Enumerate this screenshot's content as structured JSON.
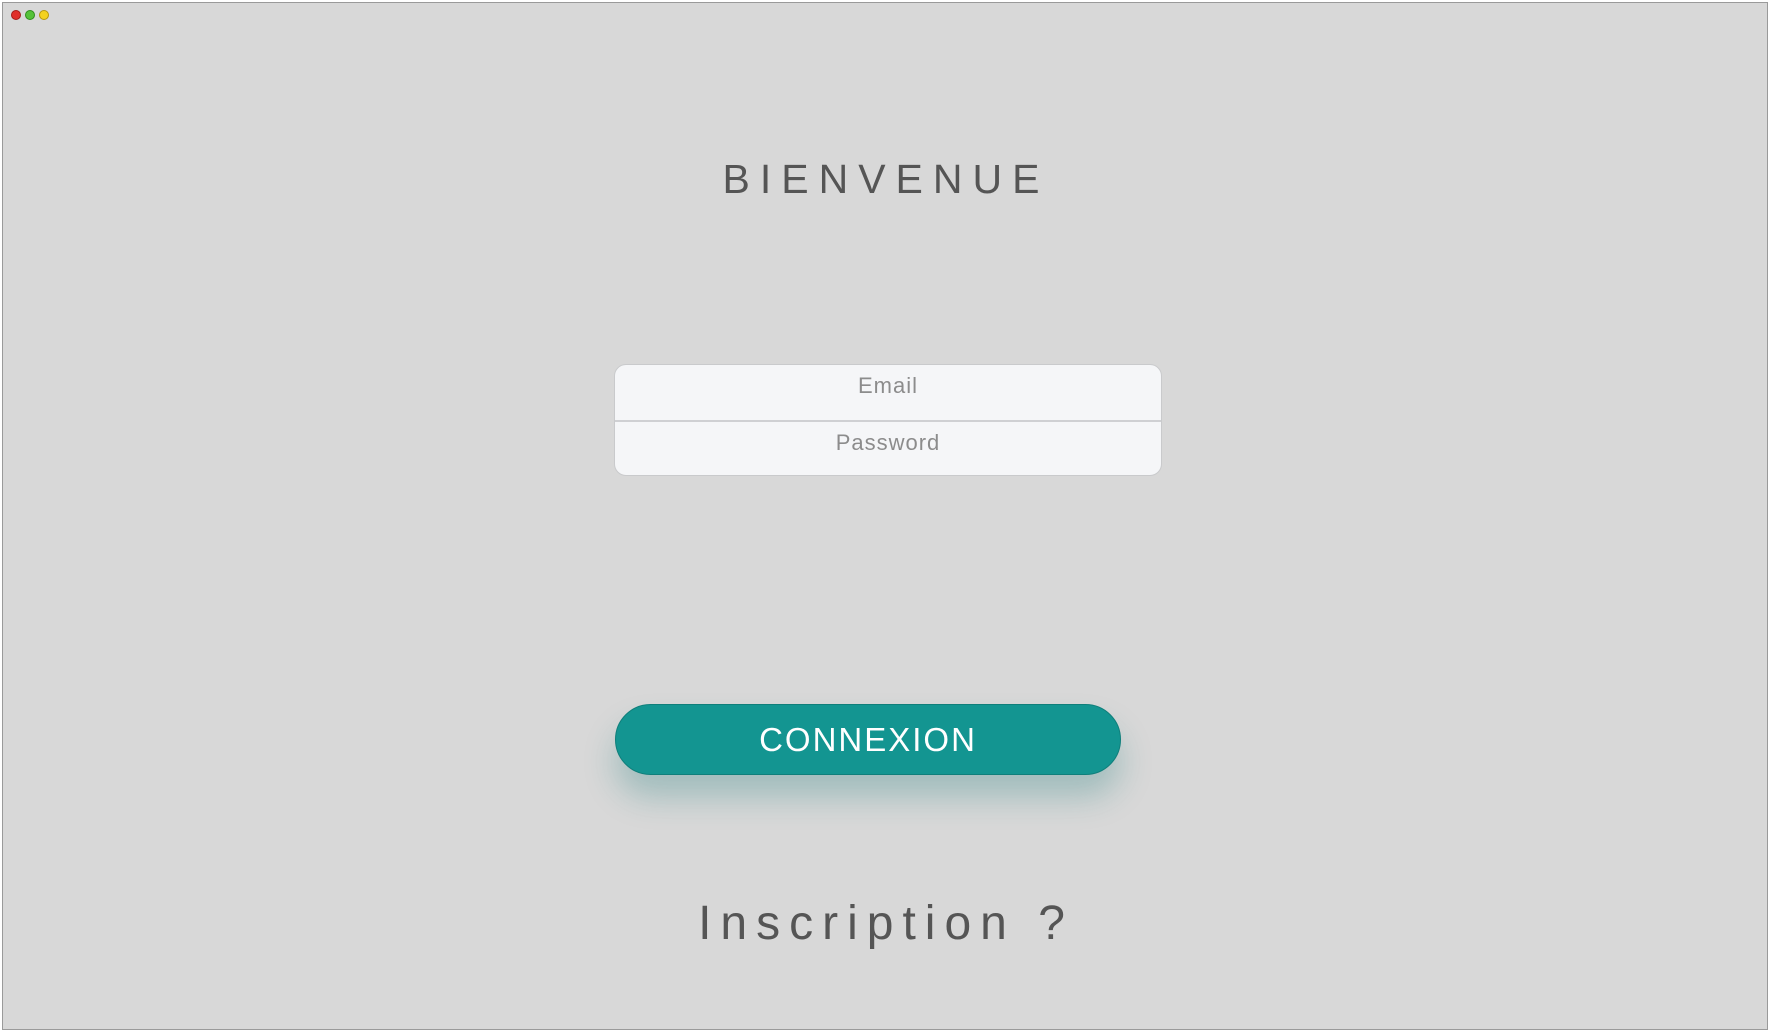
{
  "window": {
    "controls": [
      "close-button",
      "minimize-button",
      "maximize-button"
    ]
  },
  "header": {
    "title": "BIENVENUE"
  },
  "form": {
    "email_placeholder": "Email",
    "email_value": "",
    "password_placeholder": "Password",
    "password_value": ""
  },
  "actions": {
    "connect_label": "CONNEXION",
    "signup_label": "Inscription ?"
  },
  "colors": {
    "background": "#d8d8d8",
    "accent": "#139591",
    "text": "#555555",
    "input_bg": "#f5f6f8"
  }
}
